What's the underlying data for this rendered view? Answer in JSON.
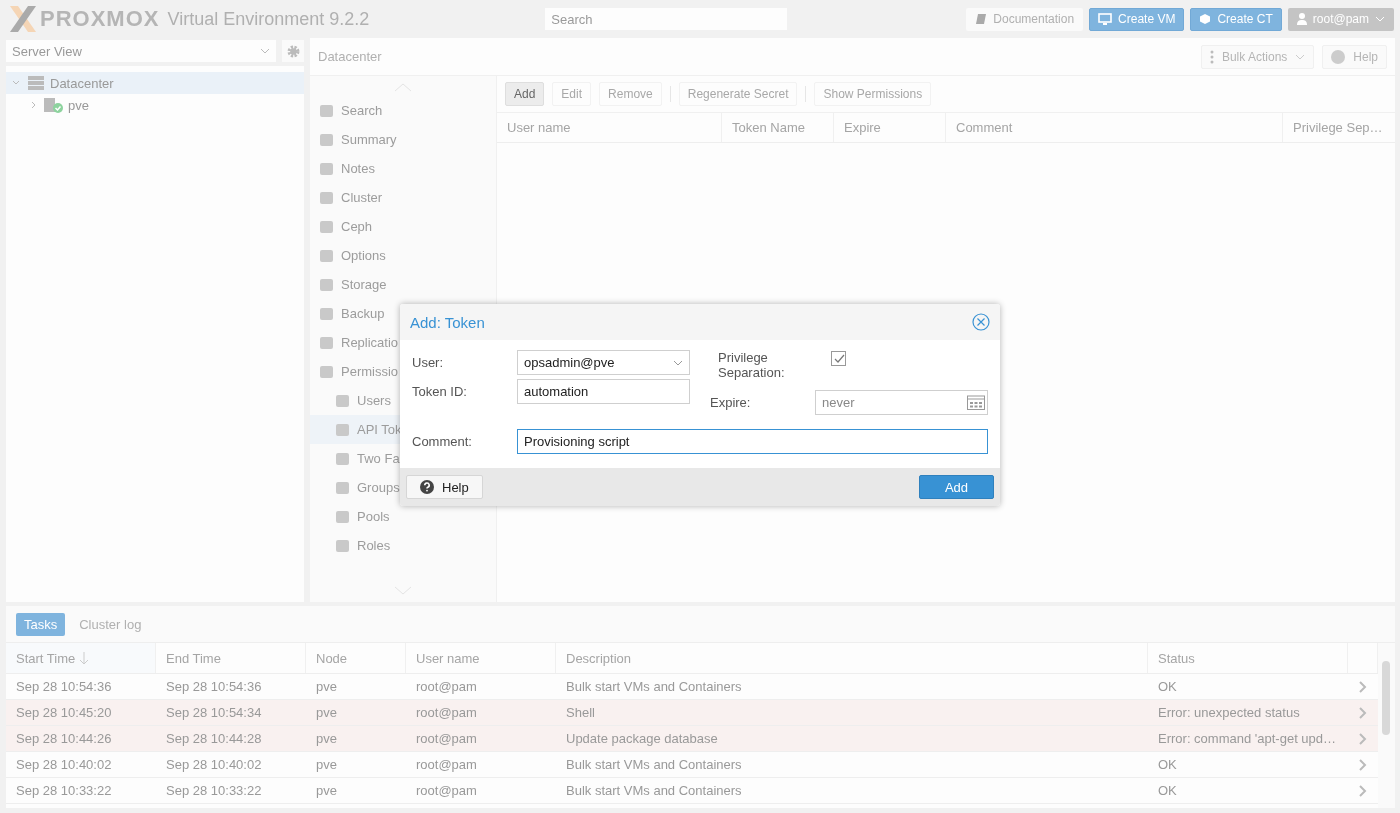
{
  "header": {
    "logo": "PROXMOX",
    "product": "Virtual Environment 9.2.2",
    "search": {
      "placeholder": "Search"
    },
    "buttons": [
      {
        "label": "Documentation",
        "kind": "doc"
      },
      {
        "label": "Create VM",
        "kind": "vm"
      },
      {
        "label": "Create CT",
        "kind": "ct"
      }
    ],
    "user_menu": "root@pam"
  },
  "sidebar": {
    "view": "Server View",
    "tree": [
      {
        "label": "Datacenter",
        "selected": true,
        "expanded": true,
        "children": [
          {
            "label": "pve",
            "selected": false,
            "expanded": false
          }
        ]
      }
    ]
  },
  "panel": {
    "title": "Datacenter",
    "bulk_actions": "Bulk Actions",
    "help": "Help",
    "nav": [
      {
        "label": "Search",
        "selected": false
      },
      {
        "label": "Summary",
        "selected": false
      },
      {
        "label": "Notes",
        "selected": false
      },
      {
        "label": "Cluster",
        "selected": false
      },
      {
        "label": "Ceph",
        "selected": false
      },
      {
        "label": "Options",
        "selected": false
      },
      {
        "label": "Storage",
        "selected": false
      },
      {
        "label": "Backup",
        "selected": false
      },
      {
        "label": "Replicatio",
        "selected": false
      },
      {
        "label": "Permissio",
        "selected": false,
        "children": [
          {
            "label": "Users",
            "selected": false
          },
          {
            "label": "API Tok",
            "selected": true
          },
          {
            "label": "Two Fa",
            "selected": false
          },
          {
            "label": "Groups",
            "selected": false
          },
          {
            "label": "Pools",
            "selected": false
          },
          {
            "label": "Roles",
            "selected": false
          }
        ]
      }
    ],
    "toolbar": [
      {
        "label": "Add",
        "disabled": false
      },
      {
        "label": "Edit",
        "disabled": true
      },
      {
        "label": "Remove",
        "disabled": true
      },
      {
        "label": "Regenerate Secret",
        "disabled": true
      },
      {
        "label": "Show Permissions",
        "disabled": true
      }
    ],
    "columns": [
      "User name",
      "Token Name",
      "Expire",
      "Comment",
      "Privilege Sep…"
    ]
  },
  "tasks": {
    "tabs": [
      {
        "label": "Tasks",
        "selected": true
      },
      {
        "label": "Cluster log",
        "selected": false
      }
    ],
    "columns": [
      "Start Time",
      "End Time",
      "Node",
      "User name",
      "Description",
      "Status"
    ],
    "rows": [
      {
        "start": "Sep 28 10:54:36",
        "end": "Sep 28 10:54:36",
        "node": "pve",
        "user": "root@pam",
        "description": "Bulk start VMs and Containers",
        "status": "OK",
        "kind": "ok"
      },
      {
        "start": "Sep 28 10:45:20",
        "end": "Sep 28 10:54:34",
        "node": "pve",
        "user": "root@pam",
        "description": "Shell",
        "status": "Error: unexpected status",
        "kind": "error"
      },
      {
        "start": "Sep 28 10:44:26",
        "end": "Sep 28 10:44:28",
        "node": "pve",
        "user": "root@pam",
        "description": "Update package database",
        "status": "Error: command 'apt-get upd…",
        "kind": "error"
      },
      {
        "start": "Sep 28 10:40:02",
        "end": "Sep 28 10:40:02",
        "node": "pve",
        "user": "root@pam",
        "description": "Bulk start VMs and Containers",
        "status": "OK",
        "kind": "ok"
      },
      {
        "start": "Sep 28 10:33:22",
        "end": "Sep 28 10:33:22",
        "node": "pve",
        "user": "root@pam",
        "description": "Bulk start VMs and Containers",
        "status": "OK",
        "kind": "ok"
      }
    ]
  },
  "dialog": {
    "title": "Add: Token",
    "user": {
      "label": "User:",
      "value": "opsadmin@pve"
    },
    "token_id": {
      "label": "Token ID:",
      "value": "automation"
    },
    "privilege_separation": {
      "label": "Privilege Separation:",
      "checked": true
    },
    "expire": {
      "label": "Expire:",
      "placeholder": "never"
    },
    "comment": {
      "label": "Comment:",
      "value": "Provisioning script",
      "focused": true
    },
    "help": "Help",
    "submit": "Add"
  }
}
